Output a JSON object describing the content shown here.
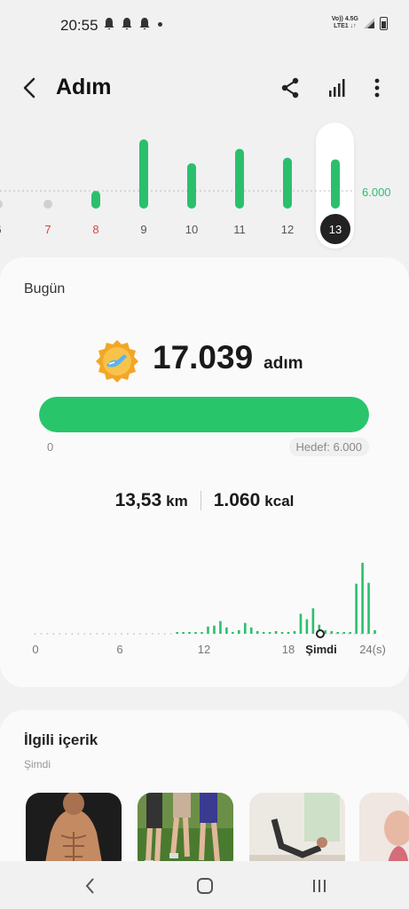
{
  "status": {
    "time": "20:55",
    "network_top": "Vo)) 4.5G",
    "network_bottom": "LTE1 ↓↑"
  },
  "header": {
    "title": "Adım"
  },
  "weekly": {
    "days": [
      "6",
      "7",
      "8",
      "9",
      "10",
      "11",
      "12",
      "13"
    ],
    "values": [
      0,
      0,
      3200,
      12500,
      8200,
      10800,
      9200,
      8900
    ],
    "goal_label": "6.000",
    "selected_day": "13",
    "colors": {
      "bar": "#2bbf6d",
      "inactive": "#d0d0d0",
      "weekend": "#d64545",
      "selected": "#222222"
    }
  },
  "today": {
    "title": "Bugün",
    "steps": "17.039",
    "steps_unit": "adım",
    "progress": 1.0,
    "start_label": "0",
    "goal_label": "Hedef: 6.000",
    "distance": "13,53",
    "distance_unit": "km",
    "calories": "1.060",
    "calories_unit": "kcal"
  },
  "hourly": {
    "x_labels": [
      "0",
      "6",
      "12",
      "18",
      "24(s)"
    ],
    "now_label": "Şimdi",
    "segments": [
      0,
      0,
      0,
      0,
      0,
      0,
      0,
      0,
      0,
      0,
      0,
      0,
      0,
      0,
      0,
      0,
      0,
      0,
      0,
      0,
      0,
      0,
      0,
      2,
      2,
      2,
      2,
      1,
      8,
      9,
      14,
      7,
      2,
      4,
      12,
      7,
      3,
      2,
      2,
      3,
      2,
      2,
      3,
      22,
      16,
      28,
      10,
      4,
      3,
      2,
      2,
      2,
      55,
      78,
      56,
      4
    ],
    "color": "#2bbf6d"
  },
  "related": {
    "title": "İlgili içerik",
    "subtitle": "Şimdi"
  }
}
